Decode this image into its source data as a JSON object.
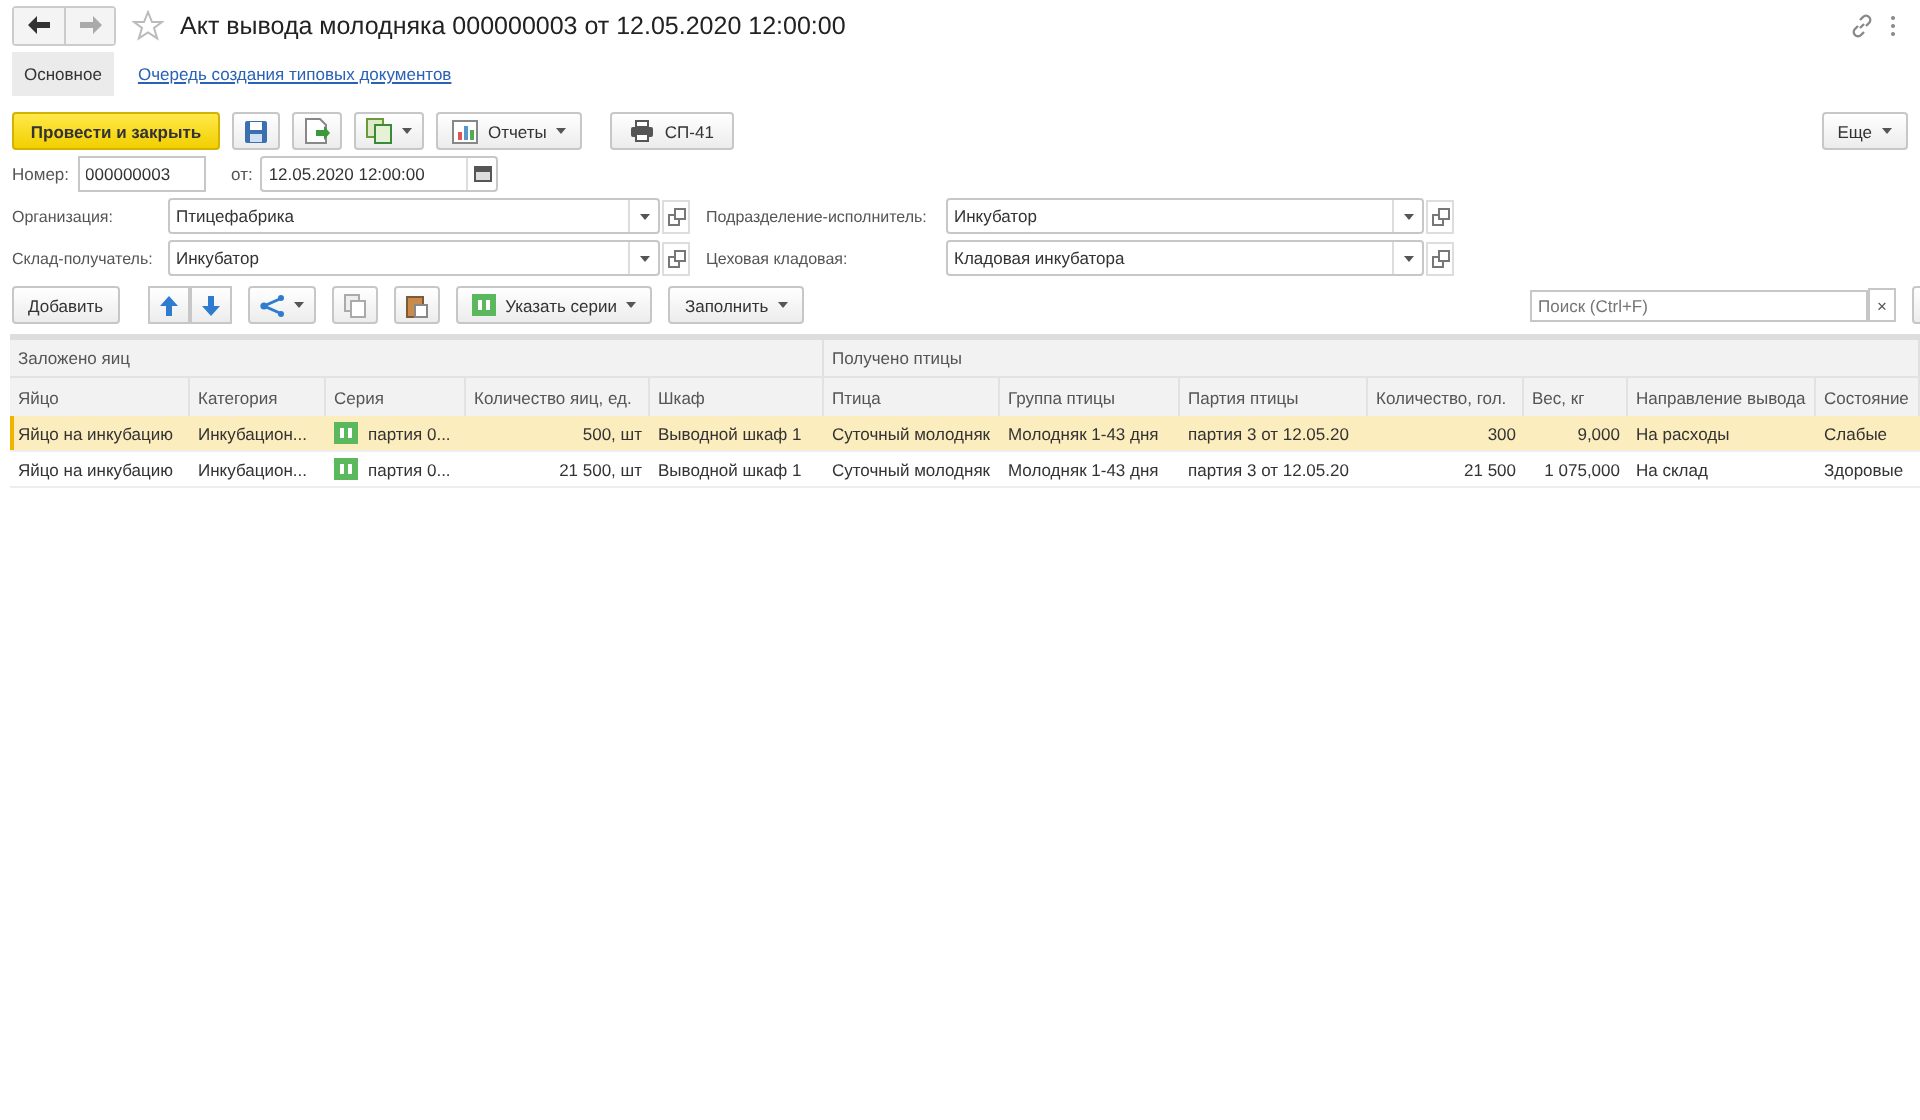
{
  "window": {
    "title": "Акт вывода молодняка 000000003 от 12.05.2020 12:00:00"
  },
  "tabs": [
    {
      "label": "Основное",
      "selected": true
    },
    {
      "label": "Очередь создания типовых документов",
      "selected": false
    }
  ],
  "toolbar": {
    "primary": "Провести и закрыть",
    "reports": "Отчеты",
    "print": "СП-41",
    "more": "Еще"
  },
  "number": {
    "label": "Номер:",
    "value": "000000003",
    "date_label": "от:",
    "date": "12.05.2020 12:00:00"
  },
  "fields": [
    {
      "label": "Организация:",
      "value": "Птицефабрика"
    },
    {
      "label": "Подразделение-исполнитель:",
      "value": "Инкубатор"
    },
    {
      "label": "Склад-получатель:",
      "value": "Инкубатор"
    },
    {
      "label": "Цеховая кладовая:",
      "value": "Кладовая инкубатора"
    }
  ],
  "table_toolbar": {
    "add": "Добавить",
    "series": "Указать серии",
    "fill": "Заполнить",
    "search_placeholder": "Поиск (Ctrl+F)",
    "clear": "×"
  },
  "table": {
    "groups": [
      {
        "label": "Заложено яиц"
      },
      {
        "label": "Получено птицы"
      }
    ],
    "columns": [
      {
        "label": "Яйцо",
        "kind": "text"
      },
      {
        "label": "Категория",
        "kind": "text"
      },
      {
        "label": "Серия",
        "kind": "series"
      },
      {
        "label": "Количество яиц, ед.",
        "kind": "number"
      },
      {
        "label": "Шкаф",
        "kind": "text"
      },
      {
        "label": "Птица",
        "kind": "text"
      },
      {
        "label": "Группа птицы",
        "kind": "text"
      },
      {
        "label": "Партия птицы",
        "kind": "text"
      },
      {
        "label": "Количество, гол.",
        "kind": "number"
      },
      {
        "label": "Вес, кг",
        "kind": "number"
      },
      {
        "label": "Направление вывода",
        "kind": "text"
      },
      {
        "label": "Состояние",
        "kind": "text"
      }
    ],
    "rows": [
      {
        "selected": true,
        "cells": [
          "Яйцо на инкубацию",
          "Инкубацион...",
          "партия 0...",
          "500, шт",
          "Выводной шкаф 1",
          "Суточный молодняк",
          "Молодняк 1-43 дня",
          "партия 3 от 12.05.20",
          "300",
          "9,000",
          "На расходы",
          "Слабые"
        ]
      },
      {
        "selected": false,
        "cells": [
          "Яйцо на инкубацию",
          "Инкубацион...",
          "партия 0...",
          "21 500, шт",
          "Выводной шкаф 1",
          "Суточный молодняк",
          "Молодняк 1-43 дня",
          "партия 3 от 12.05.20",
          "21 500",
          "1 075,000",
          "На склад",
          "Здоровые"
        ]
      }
    ]
  }
}
